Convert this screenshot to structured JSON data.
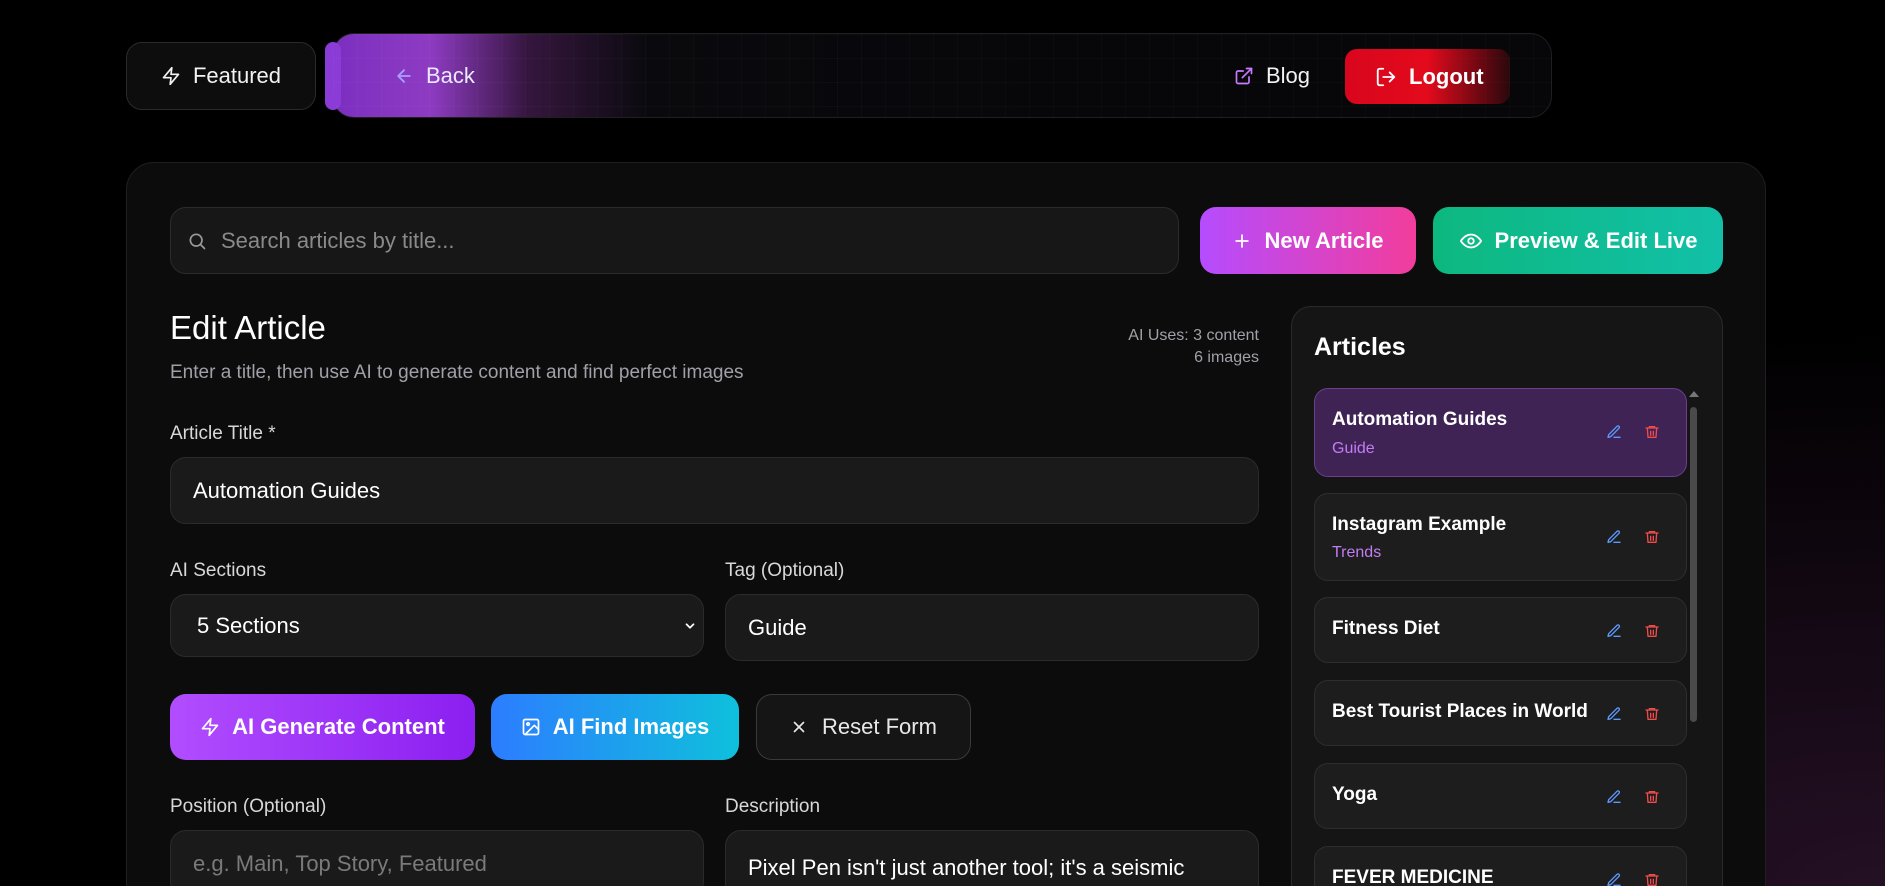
{
  "nav": {
    "featured_label": "Featured",
    "back_label": "Back",
    "blog_label": "Blog",
    "logout_label": "Logout"
  },
  "toolbar": {
    "search_placeholder": "Search articles by title...",
    "new_article_label": "New Article",
    "preview_label": "Preview & Edit Live"
  },
  "editor": {
    "title": "Edit Article",
    "subtitle": "Enter a title, then use AI to generate content and find perfect images",
    "ai_uses_line1": "AI Uses: 3 content",
    "ai_uses_line2": "6 images",
    "article_title_label": "Article Title *",
    "article_title_value": "Automation Guides",
    "ai_sections_label": "AI Sections",
    "ai_sections_value": "5 Sections",
    "tag_label": "Tag (Optional)",
    "tag_value": "Guide",
    "generate_label": "AI Generate Content",
    "find_images_label": "AI Find Images",
    "reset_label": "Reset Form",
    "position_label": "Position (Optional)",
    "position_placeholder": "e.g. Main, Top Story, Featured",
    "description_label": "Description",
    "description_value": "Pixel Pen isn't just another tool; it's a seismic"
  },
  "sidebar": {
    "title": "Articles",
    "articles": [
      {
        "name": "Automation Guides",
        "tag": "Guide"
      },
      {
        "name": "Instagram Example",
        "tag": "Trends"
      },
      {
        "name": "Fitness Diet",
        "tag": ""
      },
      {
        "name": "Best Tourist Places in World",
        "tag": ""
      },
      {
        "name": "Yoga",
        "tag": ""
      },
      {
        "name": "FEVER MEDICINE",
        "tag": ""
      }
    ]
  },
  "colors": {
    "accent_purple": "#b54cff",
    "accent_pink": "#f23d9c",
    "accent_green": "#0db87f",
    "accent_blue": "#2c7dff",
    "danger_red": "#e30a1c",
    "tag_purple": "#c47cf5"
  },
  "icons": {
    "featured": "zap-icon",
    "back": "arrow-left-icon",
    "blog": "external-link-icon",
    "logout": "logout-icon",
    "search": "search-icon",
    "new": "plus-icon",
    "preview": "eye-icon",
    "generate": "zap-icon",
    "images": "image-icon",
    "reset": "close-icon",
    "edit": "pencil-icon",
    "delete": "trash-icon"
  }
}
